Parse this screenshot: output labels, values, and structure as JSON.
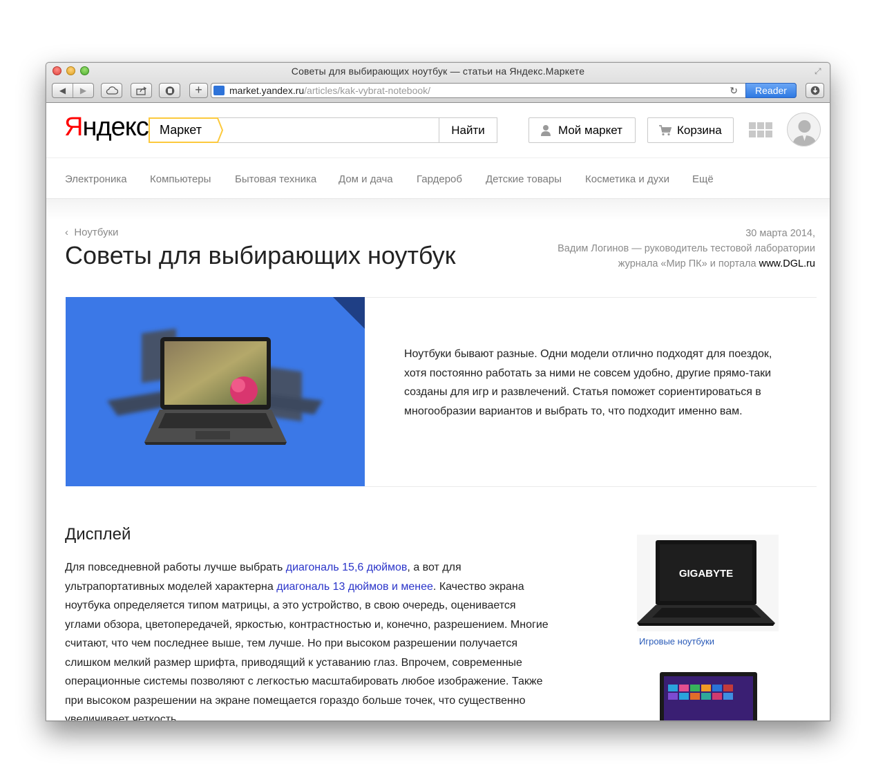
{
  "browser": {
    "window_title": "Советы для выбирающих ноутбук — статьи на Яндекс.Маркете",
    "url_host": "market.yandex.ru",
    "url_path": "/articles/kak-vybrat-notebook/",
    "reader_label": "Reader"
  },
  "header": {
    "logo_first": "Я",
    "logo_rest": "ндекс",
    "market_tag": "Маркет",
    "search_value": "",
    "search_placeholder": "",
    "find_label": "Найти",
    "my_market_label": "Мой маркет",
    "cart_label": "Корзина"
  },
  "categories": [
    "Электроника",
    "Компьютеры",
    "Бытовая техника",
    "Дом и дача",
    "Гардероб",
    "Детские товары",
    "Косметика и духи",
    "Ещё"
  ],
  "article": {
    "breadcrumb": "Ноутбуки",
    "title": "Советы для выбирающих ноутбук",
    "date": "30 марта 2014,",
    "author_line1": "Вадим Логинов — руководитель тестовой лаборатории",
    "author_line2": "журнала «Мир ПК» и портала",
    "author_site": "www.DGL.ru",
    "intro": "Ноутбуки бывают разные. Одни модели отлично подходят для поездок, хотя постоянно работать за ними не совсем удобно, другие прямо-таки созданы для игр и развлечений. Статья поможет сориентироваться в многообразии вариантов и выбрать то, что подходит именно вам."
  },
  "section": {
    "heading": "Дисплей",
    "p1": "Для повседневной работы лучше выбрать ",
    "link1": "диагональ 15,6 дюймов",
    "p2": ", а вот для ультрапортативных моделей характерна ",
    "link2": "диагональ 13 дюймов и менее",
    "p3": ". Качество экрана ноутбука определяется типом матрицы, а это устройство, в свою очередь, оценивается углами обзора, цветопередачей, яркостью, контрастностью и, конечно, разрешением. Многие считают, что чем последнее выше, тем лучше. Но при высоком разрешении получается слишком мелкий размер шрифта, приводящий к уставанию глаз. Впрочем, современные операционные системы позволяют с легкостью масштабировать любое изображение. Также при высоком разрешении на экране помещается гораздо больше точек, что существенно увеличивает четкость"
  },
  "sidebar": {
    "product1_brand": "GIGABYTE",
    "product1_link": "Игровые ноутбуки"
  }
}
